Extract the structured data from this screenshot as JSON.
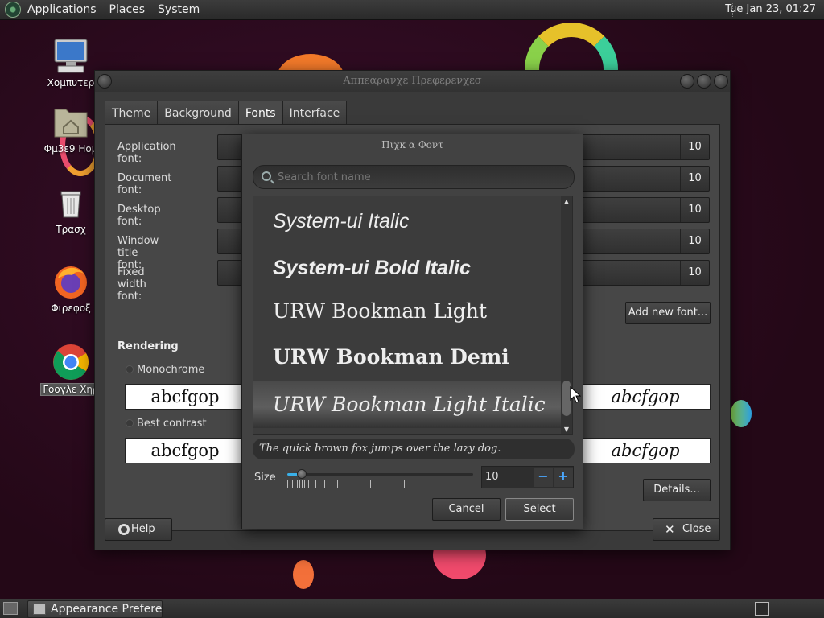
{
  "top_panel": {
    "menus": [
      "Applications",
      "Places",
      "System"
    ],
    "clock": "Tue Jan 23, 01:27"
  },
  "desktop_icons": [
    {
      "label": "Χομπυτερ",
      "icon": "computer-icon"
    },
    {
      "label": "Φμ3ε9 Ηομ",
      "icon": "home-folder-icon"
    },
    {
      "label": "Τρασχ",
      "icon": "trash-icon"
    },
    {
      "label": "Φιρεφοξ",
      "icon": "firefox-icon"
    },
    {
      "label": "Γοογλε Χηρ",
      "icon": "chrome-icon"
    }
  ],
  "window": {
    "title": "Αππεαρανχε Πρεφερενχεσ",
    "tabs": [
      "Theme",
      "Background",
      "Fonts",
      "Interface"
    ],
    "active_tab": "Fonts",
    "font_rows": [
      {
        "label": "Application font:",
        "size": "10"
      },
      {
        "label": "Document font:",
        "size": "10"
      },
      {
        "label": "Desktop font:",
        "size": "10"
      },
      {
        "label": "Window title font:",
        "size": "10"
      },
      {
        "label": "Fixed width font:",
        "size": "10"
      }
    ],
    "add_font_button": "Add new font...",
    "rendering_title": "Rendering",
    "rendering_options": [
      {
        "label": "Monochrome",
        "left_preview": "abcfgop",
        "right_preview": "abcfgop"
      },
      {
        "label": "Best contrast",
        "left_preview": "abcfgop",
        "right_preview": "abcfgop"
      }
    ],
    "details_button": "Details...",
    "help_button": "Help",
    "close_button": "Close"
  },
  "dialog": {
    "title": "Πιχκ α Φοντ",
    "search_placeholder": "Search font name",
    "fonts": [
      {
        "name": "System-ui Italic",
        "family": "Liberation Sans",
        "weight": "normal",
        "style": "italic",
        "selected": false
      },
      {
        "name": "System-ui Bold Italic",
        "family": "Liberation Sans",
        "weight": "bold",
        "style": "italic",
        "selected": false
      },
      {
        "name": "URW Bookman Light",
        "family": "DejaVu Serif",
        "weight": "normal",
        "style": "normal",
        "selected": false
      },
      {
        "name": "URW Bookman Demi",
        "family": "DejaVu Serif",
        "weight": "bold",
        "style": "normal",
        "selected": false
      },
      {
        "name": "URW Bookman Light Italic",
        "family": "DejaVu Serif",
        "weight": "normal",
        "style": "italic",
        "selected": true
      }
    ],
    "sample_text": "The quick brown fox jumps over the lazy dog.",
    "size_label": "Size",
    "size_value": "10",
    "slider_fraction": 0.06,
    "cancel_button": "Cancel",
    "select_button": "Select"
  },
  "taskbar": {
    "task_label": "Appearance Prefere..."
  },
  "colors": {
    "accent": "#3ab0e8",
    "wallpaper": "#2b0a1f"
  }
}
